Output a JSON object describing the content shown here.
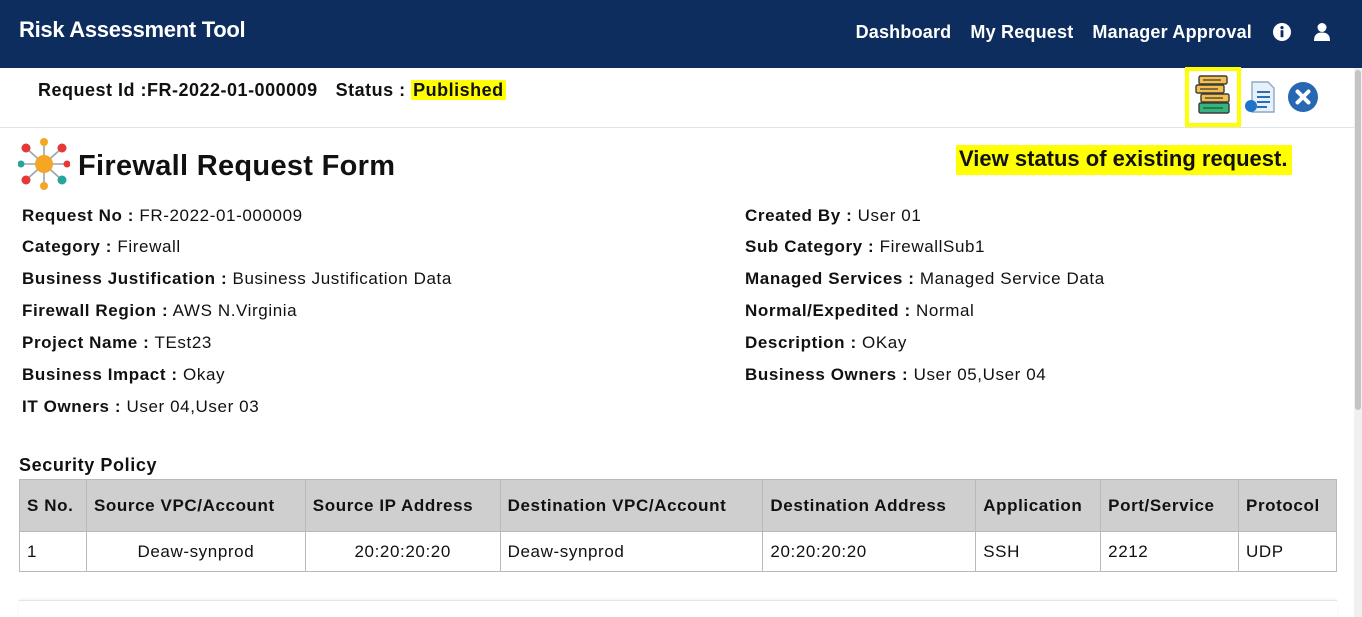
{
  "app": {
    "title": "Risk Assessment Tool"
  },
  "nav": {
    "links": [
      "Dashboard",
      "My Request",
      "Manager Approval"
    ],
    "icons": [
      "info-icon",
      "user-icon"
    ]
  },
  "subheader": {
    "request_id_label": "Request Id :",
    "request_id": "FR-2022-01-000009",
    "status_label": "Status :",
    "status": "Published",
    "actions": [
      "view-status-icon",
      "document-icon",
      "close-icon"
    ]
  },
  "form": {
    "title": "Firewall Request Form",
    "tooltip": "View status of existing request.",
    "left_fields": [
      {
        "label": "Request No :",
        "value": "FR-2022-01-000009"
      },
      {
        "label": "Category :",
        "value": "Firewall"
      },
      {
        "label": "Business Justification :",
        "value": "Business Justification Data"
      },
      {
        "label": "Firewall Region :",
        "value": "AWS N.Virginia"
      },
      {
        "label": "Project Name :",
        "value": "TEst23"
      },
      {
        "label": "Business Impact :",
        "value": "Okay"
      },
      {
        "label": "IT Owners :",
        "value": "User 04,User 03"
      }
    ],
    "right_fields": [
      {
        "label": "Created By :",
        "value": "User 01"
      },
      {
        "label": "Sub Category :",
        "value": "FirewallSub1"
      },
      {
        "label": "Managed Services :",
        "value": "Managed Service Data"
      },
      {
        "label": "Normal/Expedited :",
        "value": "Normal"
      },
      {
        "label": "Description :",
        "value": "OKay"
      },
      {
        "label": "Business Owners :",
        "value": "User 05,User 04"
      }
    ]
  },
  "security_policy": {
    "title": "Security Policy",
    "columns": [
      "S No.",
      "Source VPC/Account",
      "Source IP Address",
      "Destination VPC/Account",
      "Destination Address",
      "Application",
      "Port/Service",
      "Protocol"
    ],
    "rows": [
      [
        "1",
        "Deaw-synprod",
        "20:20:20:20",
        "Deaw-synprod",
        "20:20:20:20",
        "SSH",
        "2212",
        "UDP"
      ]
    ]
  },
  "colors": {
    "navbar": "#0d2d5e",
    "highlight": "#ffff00",
    "table_header": "#cfcfcf"
  }
}
